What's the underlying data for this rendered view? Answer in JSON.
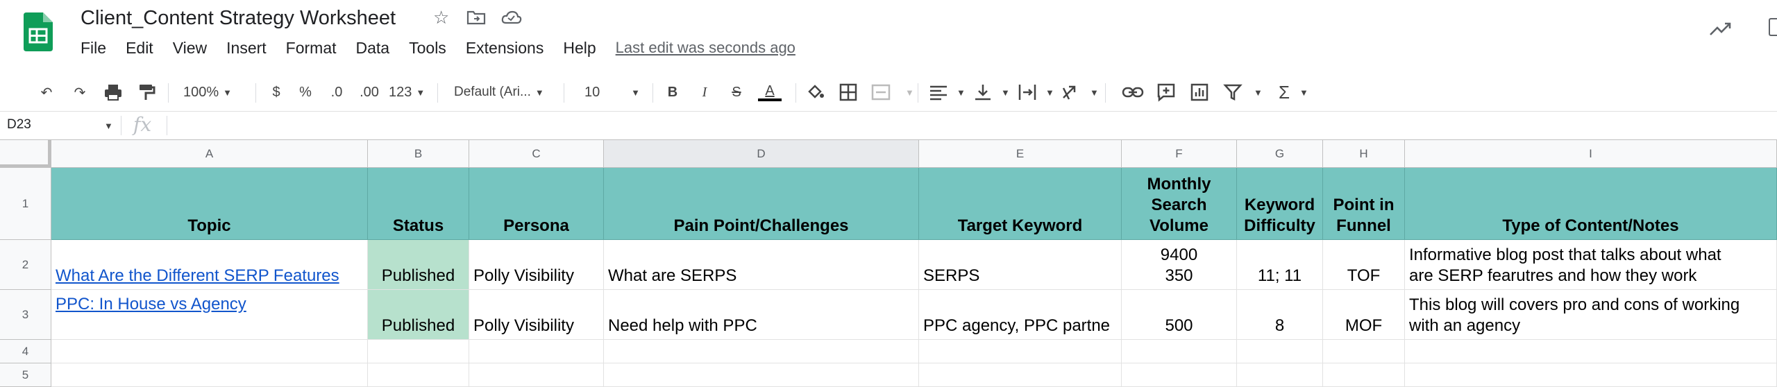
{
  "doc": {
    "title": "Client_Content Strategy Worksheet",
    "star_icon": "star-icon",
    "move_icon": "move-to-folder-icon",
    "cloud_icon": "cloud-status-icon"
  },
  "menu": [
    "File",
    "Edit",
    "View",
    "Insert",
    "Format",
    "Data",
    "Tools",
    "Extensions",
    "Help"
  ],
  "last_edit": "Last edit was seconds ago",
  "toolbar": {
    "zoom": "100%",
    "currency": "$",
    "percent": "%",
    "dec_decrease": ".0",
    "dec_increase": ".00",
    "more_formats": "123",
    "font": "Default (Ari...",
    "font_size": "10",
    "bold": "B",
    "italic": "I",
    "strike": "S",
    "text_color": "A"
  },
  "formula_bar": {
    "cell_ref": "D23",
    "fx": "fx"
  },
  "columns": [
    "A",
    "B",
    "C",
    "D",
    "E",
    "F",
    "G",
    "H",
    "I"
  ],
  "rows": [
    "1",
    "2",
    "3",
    "4",
    "5"
  ],
  "header_row": {
    "a": "Topic",
    "b": "Status",
    "c": "Persona",
    "d": "Pain Point/Challenges",
    "e": "Target Keyword",
    "f": [
      "Monthly",
      "Search",
      "Volume"
    ],
    "g": [
      "Keyword",
      "Difficulty"
    ],
    "h": [
      "Point in",
      "Funnel"
    ],
    "i": "Type of Content/Notes"
  },
  "data_rows": [
    {
      "topic": "What Are the Different SERP Features",
      "status": "Published",
      "persona": "Polly Visibility",
      "pain": "What are SERPS",
      "keyword": "SERPS",
      "volume": [
        "9400",
        "350"
      ],
      "difficulty": "11; 11",
      "funnel": "TOF",
      "notes": [
        "Informative blog post that talks about what",
        "are SERP fearutres and how they work"
      ]
    },
    {
      "topic": "PPC: In House vs Agency",
      "status": "Published",
      "persona": "Polly Visibility",
      "pain": "Need help with PPC",
      "keyword": "PPC agency, PPC partne",
      "volume": [
        "500"
      ],
      "difficulty": "8",
      "funnel": "MOF",
      "notes": [
        "This blog will covers pro and cons of working",
        "with an agency"
      ]
    }
  ],
  "colors": {
    "header_fill": "#76c5c0",
    "published_fill": "#b7e1cd",
    "link": "#1155cc",
    "sheets_green": "#0f9d58"
  }
}
